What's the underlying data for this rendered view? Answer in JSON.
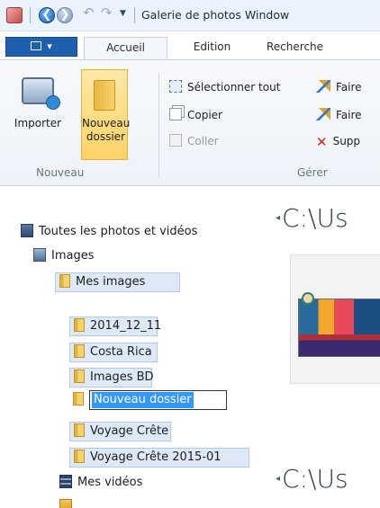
{
  "title_bar": {
    "window_title": "Galerie de photos Window",
    "back_glyph": "❮",
    "forward_glyph": "❯",
    "undo_glyph": "↶",
    "redo_glyph": "↷",
    "dropdown_glyph": "▼"
  },
  "ribbon_tabs": {
    "file_glyph": "▾",
    "tabs": [
      {
        "label": "Accueil",
        "active": true
      },
      {
        "label": "Edition",
        "active": false
      },
      {
        "label": "Recherche",
        "active": false
      }
    ]
  },
  "ribbon": {
    "nouveau_group": {
      "label": "Nouveau",
      "import_label": "Importer",
      "new_folder_line1": "Nouveau",
      "new_folder_line2": "dossier"
    },
    "gerer_group": {
      "label": "Gérer",
      "select_all": "Sélectionner tout",
      "copy": "Copier",
      "paste": "Coller",
      "faire_1": "Faire",
      "faire_2": "Faire",
      "supprimer": "Supp"
    }
  },
  "tree": {
    "items": [
      {
        "label": "Toutes les photos et vidéos",
        "icon": "all-media-icon"
      },
      {
        "label": "Images",
        "icon": "images-library-icon"
      },
      {
        "label": "Mes images",
        "icon": "folder-icon",
        "selected": true
      },
      {
        "label": "2014_12_11",
        "icon": "folder-icon",
        "selected": true
      },
      {
        "label": "Costa Rica",
        "icon": "folder-icon",
        "selected": true
      },
      {
        "label": "Images BD",
        "icon": "folder-icon",
        "selected": true
      },
      {
        "label": "Nouveau dossier",
        "icon": "folder-icon",
        "renaming": true
      },
      {
        "label": "Voyage Crête",
        "icon": "folder-icon",
        "selected": true
      },
      {
        "label": "Voyage Crête 2015-01",
        "icon": "folder-icon",
        "selected": true
      },
      {
        "label": "Mes vidéos",
        "icon": "videos-library-icon"
      }
    ]
  },
  "content": {
    "heading_1": "C:\\Us",
    "heading_2": "C:\\Us",
    "arrow_glyph": "◂"
  },
  "colors": {
    "accent_blue": "#1f5fb0",
    "selection_fill": "#dde9f6",
    "rename_highlight": "#3399ff",
    "new_folder_highlight": "#fbd265"
  }
}
